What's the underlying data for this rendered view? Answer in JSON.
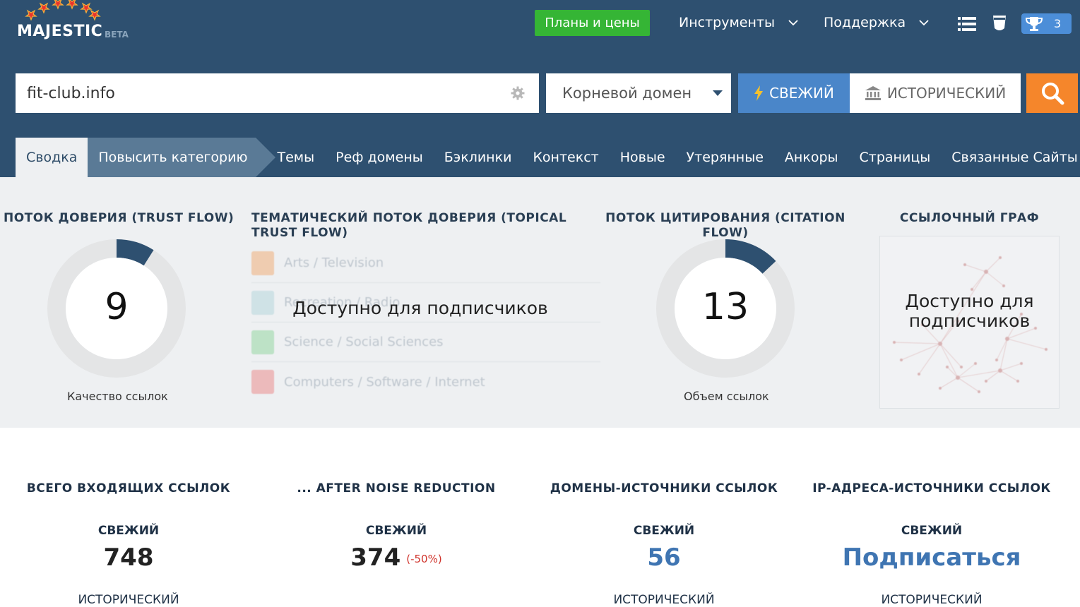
{
  "header": {
    "logo_text": "MAJESTIC",
    "logo_beta": "BETA",
    "plans_label": "Планы и цены",
    "tools_label": "Инструменты",
    "support_label": "Поддержка",
    "trophy_count": "3",
    "brand_color": "#2e5070",
    "plans_color": "#35b535"
  },
  "search": {
    "value": "fit-club.info",
    "scope": "Корневой домен",
    "fresh_label": "СВЕЖИЙ",
    "historic_label": "ИСТОРИЧЕСКИЙ",
    "fresh_color": "#4a86c9",
    "go_color": "#f5862b"
  },
  "tabs": [
    {
      "label": "Сводка",
      "active": true
    },
    {
      "label": "Повысить категорию"
    },
    {
      "label": "Темы"
    },
    {
      "label": "Реф домены"
    },
    {
      "label": "Бэклинки"
    },
    {
      "label": "Контекст"
    },
    {
      "label": "Новые"
    },
    {
      "label": "Утерянные"
    },
    {
      "label": "Анкоры"
    },
    {
      "label": "Страницы"
    },
    {
      "label": "Связанные Сайты"
    }
  ],
  "metrics": {
    "trust_flow": {
      "title": "ПОТОК ДОВЕРИЯ (TRUST FLOW)",
      "value": 9,
      "caption": "Качество ссылок"
    },
    "topical": {
      "title": "ТЕМАТИЧЕСКИЙ ПОТОК ДОВЕРИЯ (TOPICAL TRUST FLOW)",
      "overlay": "Доступно для подписчиков",
      "rows": [
        {
          "label": "Arts / Television",
          "color": "#f0a060"
        },
        {
          "label": "Recreation / Radio",
          "color": "#a8d0d8"
        },
        {
          "label": "Science / Social Sciences",
          "color": "#80d090"
        },
        {
          "label": "Computers / Software / Internet",
          "color": "#e87878"
        }
      ]
    },
    "citation_flow": {
      "title": "ПОТОК ЦИТИРОВАНИЯ (CITATION FLOW)",
      "value": 13,
      "caption": "Объем ссылок"
    },
    "link_graph": {
      "title": "ССЫЛОЧНЫЙ ГРАФ",
      "overlay": "Доступно для подписчиков"
    }
  },
  "stats": [
    {
      "title": "ВСЕГО ВХОДЯЩИХ ССЫЛОК",
      "label": "СВЕЖИЙ",
      "value": "748",
      "delta": "",
      "historic": "ИСТОРИЧЕСКИЙ"
    },
    {
      "title": "... AFTER NOISE REDUCTION",
      "label": "СВЕЖИЙ",
      "value": "374",
      "delta": "(-50%)",
      "historic": ""
    },
    {
      "title": "ДОМЕНЫ-ИСТОЧНИКИ ССЫЛОК",
      "label": "СВЕЖИЙ",
      "value": "56",
      "delta": "",
      "historic": "ИСТОРИЧЕСКИЙ"
    },
    {
      "title": "IP-АДРЕСА-ИСТОЧНИКИ ССЫЛОК",
      "label": "СВЕЖИЙ",
      "value": "Подписаться",
      "delta": "",
      "historic": "ИСТОРИЧЕСКИЙ"
    }
  ]
}
